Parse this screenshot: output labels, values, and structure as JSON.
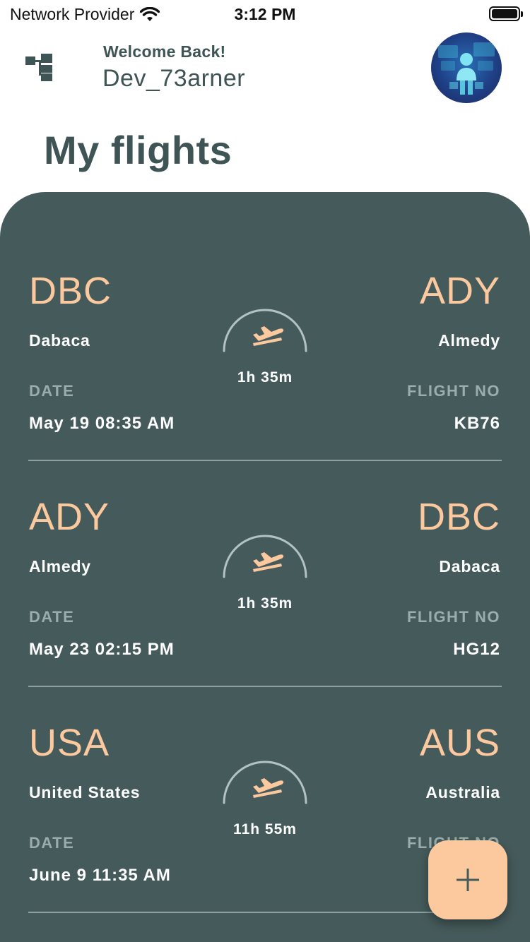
{
  "status_bar": {
    "carrier": "Network Provider",
    "time": "3:12 PM"
  },
  "header": {
    "welcome": "Welcome Back!",
    "username": "Dev_73arner",
    "menu_icon": "network-tree-icon",
    "avatar_icon": "user-avatar"
  },
  "page": {
    "title": "My flights"
  },
  "labels": {
    "date": "DATE",
    "flight_no": "FLIGHT NO"
  },
  "flights": [
    {
      "from_code": "DBC",
      "from_city": "Dabaca",
      "to_code": "ADY",
      "to_city": "Almedy",
      "duration": "1h 35m",
      "date": "May 19 08:35 AM",
      "flight_no": "KB76"
    },
    {
      "from_code": "ADY",
      "from_city": "Almedy",
      "to_code": "DBC",
      "to_city": "Dabaca",
      "duration": "1h 35m",
      "date": "May 23 02:15 PM",
      "flight_no": "HG12"
    },
    {
      "from_code": "USA",
      "from_city": "United States",
      "to_code": "AUS",
      "to_city": "Australia",
      "duration": "11h 55m",
      "date": "June 9 11:35 AM",
      "flight_no": ""
    }
  ],
  "fab": {
    "icon": "plus-icon"
  },
  "colors": {
    "panel": "#455a5a",
    "accent": "#fcc99f",
    "text_dark": "#3f5454"
  }
}
